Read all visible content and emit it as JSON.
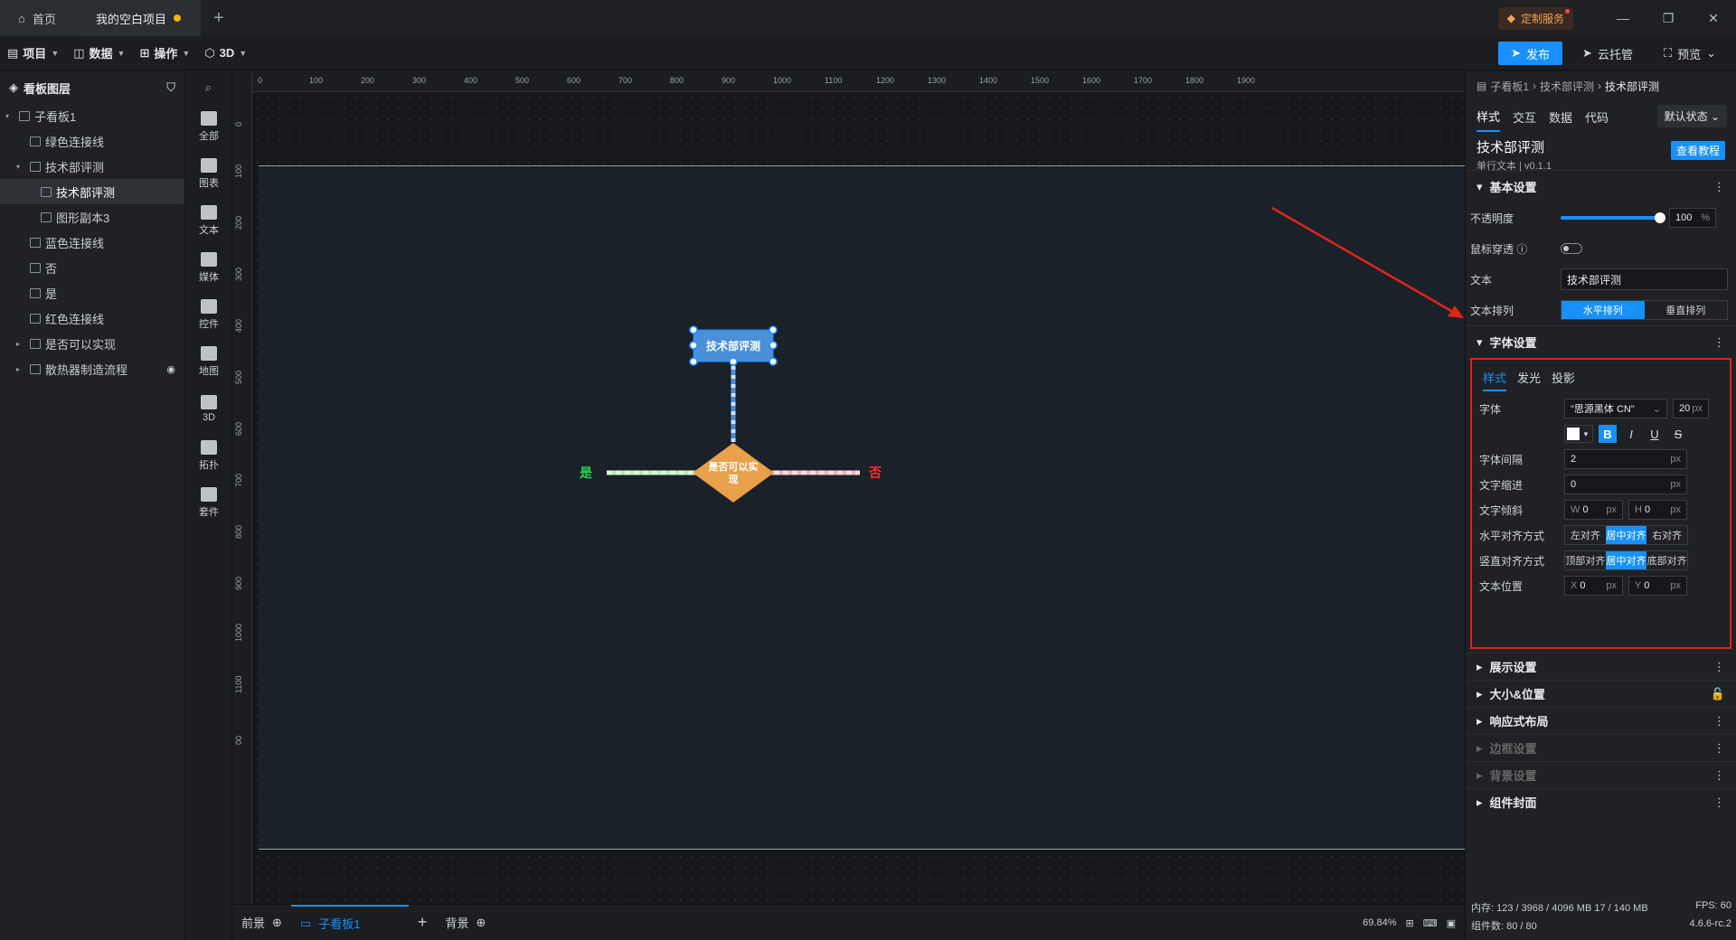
{
  "titlebar": {
    "home_label": "首页",
    "project_tab": "我的空白项目",
    "new_tab": "+",
    "custom_service": "定制服务"
  },
  "menu": {
    "items": [
      "项目",
      "数据",
      "操作",
      "3D"
    ],
    "publish": "发布",
    "cloud": "云托管",
    "preview": "预览"
  },
  "layers": {
    "title": "看板图层",
    "items": [
      {
        "label": "子看板1",
        "indent": 0,
        "caret": "▾"
      },
      {
        "label": "绿色连接线",
        "indent": 1
      },
      {
        "label": "技术部评测",
        "indent": 1,
        "caret": "▾"
      },
      {
        "label": "技术部评测",
        "indent": 2,
        "selected": true
      },
      {
        "label": "图形副本3",
        "indent": 2
      },
      {
        "label": "蓝色连接线",
        "indent": 1
      },
      {
        "label": "否",
        "indent": 1
      },
      {
        "label": "是",
        "indent": 1
      },
      {
        "label": "红色连接线",
        "indent": 1
      },
      {
        "label": "是否可以实现",
        "indent": 1,
        "caret": "▸"
      },
      {
        "label": "散热器制造流程",
        "indent": 1,
        "caret": "▸",
        "eye": true
      }
    ]
  },
  "components": [
    "全部",
    "图表",
    "文本",
    "媒体",
    "控件",
    "地图",
    "3D",
    "拓扑",
    "套件"
  ],
  "ruler": {
    "top": [
      "0",
      "100",
      "200",
      "300",
      "400",
      "500",
      "600",
      "700",
      "800",
      "900",
      "1000",
      "1100",
      "1200",
      "1300",
      "1400",
      "1500",
      "1600",
      "1700",
      "1800",
      "1900"
    ],
    "left": [
      "0",
      "100",
      "200",
      "300",
      "400",
      "500",
      "600",
      "700",
      "800",
      "900",
      "1000",
      "1100",
      "00"
    ]
  },
  "diagram": {
    "box_label": "技术部评测",
    "diamond_label": "是否可以实现",
    "yes_label": "是",
    "no_label": "否"
  },
  "bottom": {
    "front": "前景",
    "board": "子看板1",
    "add": "+",
    "background": "背景",
    "zoom": "69.84%"
  },
  "panel": {
    "breadcrumb": [
      "子看板1",
      "技术部评测",
      "技术部评测"
    ],
    "tabs": [
      "样式",
      "交互",
      "数据",
      "代码"
    ],
    "state": "默认状态",
    "comp_title": "技术部评测",
    "comp_sub": "单行文本 | v0.1.1",
    "tutorial": "查看教程",
    "basic": {
      "title": "基本设置",
      "opacity_label": "不透明度",
      "opacity_value": "100",
      "opacity_unit": "%",
      "opacity_fill": 1.0,
      "mouse_label": "鼠标穿透",
      "text_label": "文本",
      "text_value": "技术部评测",
      "arrange_label": "文本排列",
      "arrange_h": "水平排列",
      "arrange_v": "垂直排列"
    },
    "font": {
      "title": "字体设置",
      "tabs": [
        "样式",
        "发光",
        "投影"
      ],
      "family_label": "字体",
      "family_value": "\"思源黑体 CN\"",
      "size_value": "20",
      "px": "px",
      "spacing_label": "字体间隔",
      "spacing_value": "2",
      "indent_label": "文字缩进",
      "indent_value": "0",
      "skew_label": "文字倾斜",
      "skew_w": "W",
      "skew_w_value": "0",
      "skew_h": "H",
      "skew_h_value": "0",
      "halign_label": "水平对齐方式",
      "halign": [
        "左对齐",
        "居中对齐",
        "右对齐"
      ],
      "valign_label": "竖直对齐方式",
      "valign": [
        "顶部对齐",
        "居中对齐",
        "底部对齐"
      ],
      "pos_label": "文本位置",
      "pos_x": "X",
      "pos_x_value": "0",
      "pos_y": "Y",
      "pos_y_value": "0",
      "fmt": [
        "B",
        "I",
        "U",
        "S"
      ]
    },
    "sections": [
      {
        "label": "展示设置",
        "dim": false,
        "right": "⋮"
      },
      {
        "label": "大小&位置",
        "dim": false,
        "right": "🔓"
      },
      {
        "label": "响应式布局",
        "dim": false,
        "right": "⋮"
      },
      {
        "label": "边框设置",
        "dim": true,
        "right": "⋮"
      },
      {
        "label": "背景设置",
        "dim": true,
        "right": "⋮"
      },
      {
        "label": "组件封面",
        "dim": false,
        "right": "⋮"
      }
    ],
    "status": {
      "memory": "内存: 123 / 3968 / 4096 MB 17 / 140 MB",
      "fps": "FPS: 60",
      "count": "组件数: 80 / 80",
      "version": "4.6.6-rc.2"
    }
  },
  "colors": {
    "accent": "#1890ff",
    "box": "#4a90d9",
    "diamond": "#e8a04a",
    "yes": "#22d34a",
    "no": "#ff2a2a",
    "arrow": "#e0241b"
  }
}
